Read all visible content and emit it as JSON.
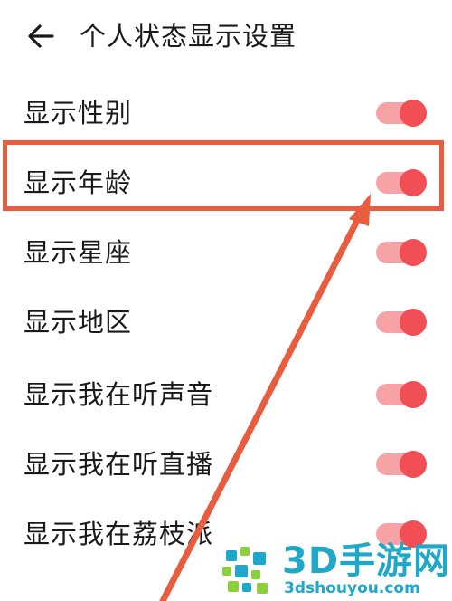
{
  "header": {
    "title": "个人状态显示设置",
    "back_icon": "arrow-left-icon"
  },
  "settings": [
    {
      "label": "显示性别",
      "enabled": true
    },
    {
      "label": "显示年龄",
      "enabled": true
    },
    {
      "label": "显示星座",
      "enabled": true
    },
    {
      "label": "显示地区",
      "enabled": true
    },
    {
      "label": "显示我在听声音",
      "enabled": true
    },
    {
      "label": "显示我在听直播",
      "enabled": true
    },
    {
      "label": "显示我在荔枝派",
      "enabled": true
    }
  ],
  "colors": {
    "toggle_track": "#f7a3a6",
    "toggle_knob": "#f24e55",
    "annotation": "#e85d3f",
    "watermark": "#1fa8c9"
  },
  "watermark": {
    "brand": "3D手游网",
    "url": "3dshouyou.com"
  }
}
